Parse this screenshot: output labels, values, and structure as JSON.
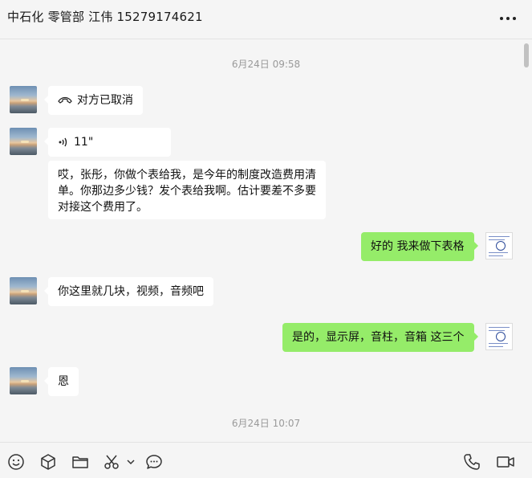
{
  "header": {
    "title": "中石化 零管部 江伟 15279174621"
  },
  "chat": {
    "timestamps": [
      "6月24日 09:58",
      "6月24日 10:07"
    ],
    "messages": [
      {
        "side": "left",
        "type": "call",
        "icon": "phone-hangup-icon",
        "text": "对方已取消"
      },
      {
        "side": "left",
        "type": "voice",
        "icon": "voice-icon",
        "text": "11\""
      },
      {
        "side": "left",
        "type": "text",
        "text": "哎，张彤，你做个表给我，是今年的制度改造费用清单。你那边多少钱？发个表给我啊。估计要差不多要对接这个费用了。"
      },
      {
        "side": "right",
        "type": "text",
        "text": "好的 我来做下表格"
      },
      {
        "side": "left",
        "type": "text",
        "text": "你这里就几块，视频，音频吧"
      },
      {
        "side": "right",
        "type": "text",
        "text": "是的，显示屏，音柱，音箱 这三个"
      },
      {
        "side": "left",
        "type": "text",
        "text": "恩"
      }
    ]
  },
  "toolbar": {
    "left_icons": [
      "emoji-icon",
      "box-icon",
      "folder-icon",
      "scissors-icon",
      "chevron-down-icon",
      "chat-bubble-icon"
    ],
    "right_icons": [
      "phone-icon",
      "video-call-icon"
    ]
  }
}
